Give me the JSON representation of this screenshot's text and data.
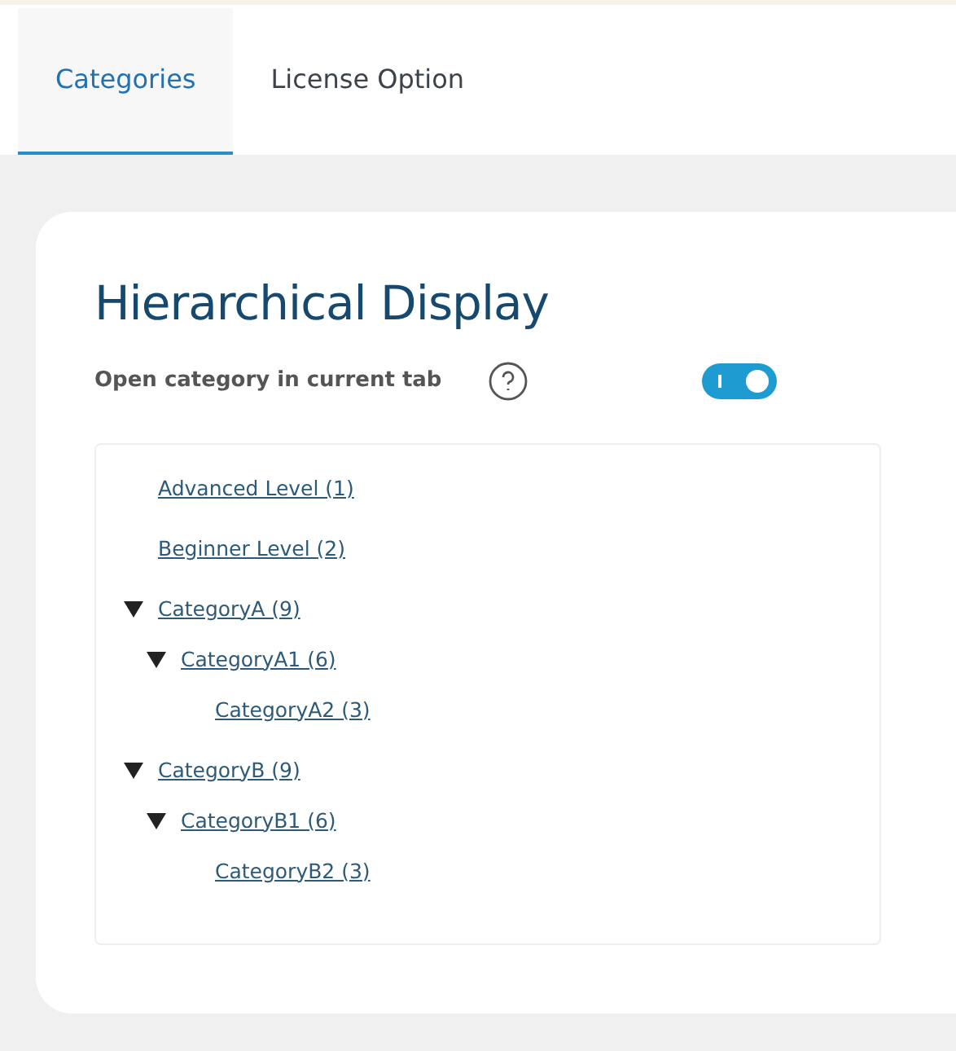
{
  "tabs": [
    {
      "label": "Categories",
      "selected": true
    },
    {
      "label": "License Option",
      "selected": false
    }
  ],
  "section": {
    "title": "Hierarchical Display",
    "setting": {
      "label": "Open category in current tab",
      "on": true
    }
  },
  "tree": [
    {
      "label": "Advanced Level (1)"
    },
    {
      "label": "Beginner Level (2)"
    },
    {
      "label": "CategoryA (9)",
      "expanded": true,
      "children": [
        {
          "label": "CategoryA1 (6)",
          "expanded": true,
          "children": [
            {
              "label": "CategoryA2 (3)"
            }
          ]
        }
      ]
    },
    {
      "label": "CategoryB (9)",
      "expanded": true,
      "children": [
        {
          "label": "CategoryB1 (6)",
          "expanded": true,
          "children": [
            {
              "label": "CategoryB2 (3)"
            }
          ]
        }
      ]
    }
  ]
}
